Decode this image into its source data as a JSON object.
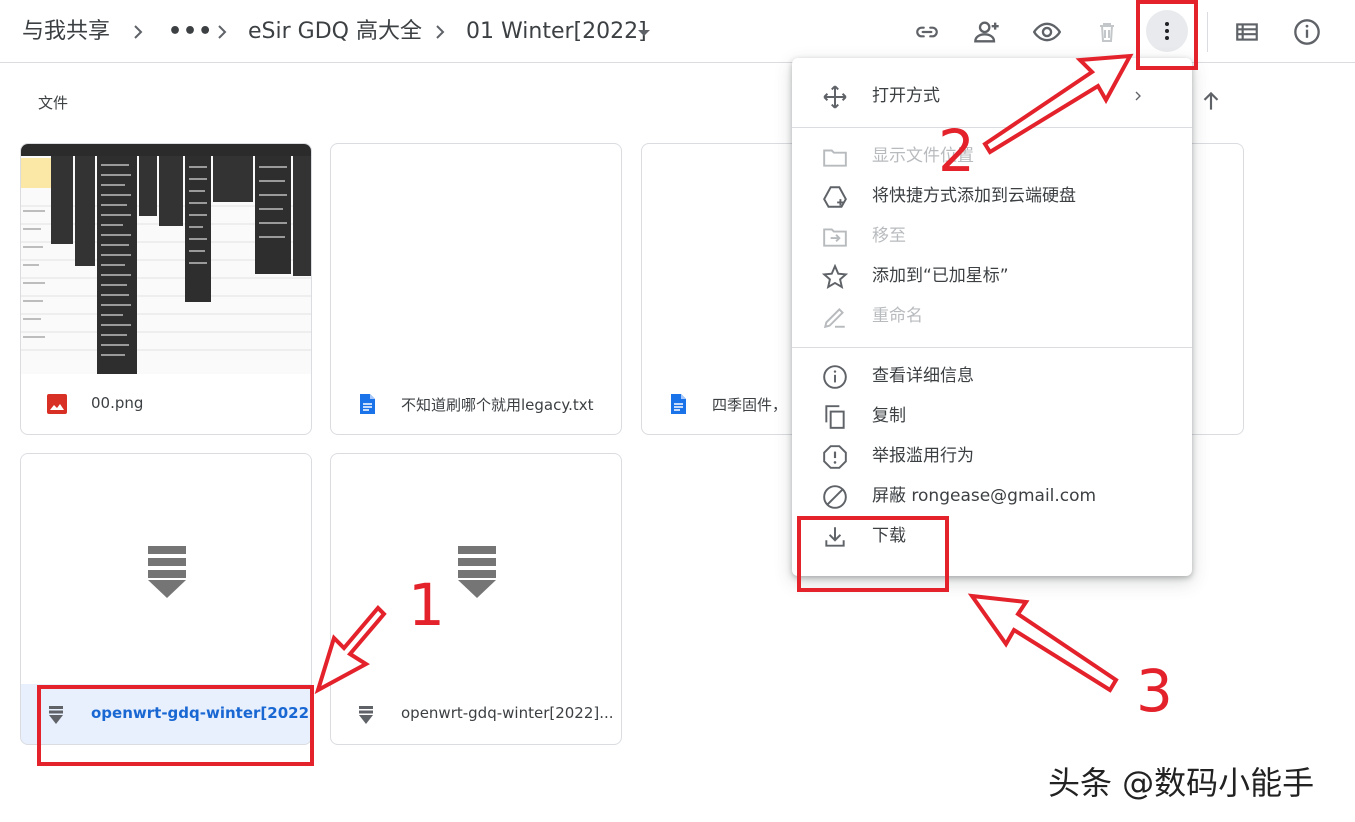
{
  "breadcrumb": {
    "items": [
      "与我共享",
      "•••",
      "eSir GDQ 高大全",
      "01 Winter[2022]"
    ]
  },
  "toolbar": {
    "icons": [
      "link-icon",
      "add-person-icon",
      "preview-icon",
      "trash-icon",
      "more-vert-icon",
      "list-view-icon",
      "info-icon"
    ]
  },
  "section": {
    "label": "文件"
  },
  "files": [
    {
      "name": "00.png",
      "type": "image"
    },
    {
      "name": "不知道刷哪个就用legacy.txt",
      "type": "doc"
    },
    {
      "name": "四季固件，",
      "type": "doc"
    },
    {
      "name": "openwrt-gdq-winter[2022]...",
      "type": "archive",
      "selected": true
    },
    {
      "name": "openwrt-gdq-winter[2022]...",
      "type": "archive"
    }
  ],
  "context_menu": {
    "items": [
      {
        "label": "打开方式",
        "icon": "open-with-icon",
        "disabled": false,
        "submenu": true
      },
      {
        "label": "显示文件位置",
        "icon": "folder-icon",
        "disabled": true
      },
      {
        "label": "将快捷方式添加到云端硬盘",
        "icon": "add-shortcut-icon",
        "disabled": false
      },
      {
        "label": "移至",
        "icon": "move-to-icon",
        "disabled": true
      },
      {
        "label": "添加到“已加星标”",
        "icon": "star-icon",
        "disabled": false
      },
      {
        "label": "重命名",
        "icon": "rename-icon",
        "disabled": true
      },
      {
        "label": "查看详细信息",
        "icon": "info-icon",
        "disabled": false
      },
      {
        "label": "复制",
        "icon": "copy-icon",
        "disabled": false
      },
      {
        "label": "举报滥用行为",
        "icon": "report-icon",
        "disabled": false
      },
      {
        "label": "屏蔽 rongease@gmail.com",
        "icon": "block-icon",
        "disabled": false
      },
      {
        "label": "下载",
        "icon": "download-icon",
        "disabled": false
      }
    ]
  },
  "annotations": {
    "step1": "1",
    "step2": "2",
    "step3": "3",
    "color": "#e4222b"
  },
  "watermark": "头条 @数码小能手",
  "colors": {
    "selected_bg": "#e8f0fe",
    "selected_text": "#1967d2",
    "image_icon": "#d93025",
    "doc_icon": "#1a73e8"
  }
}
